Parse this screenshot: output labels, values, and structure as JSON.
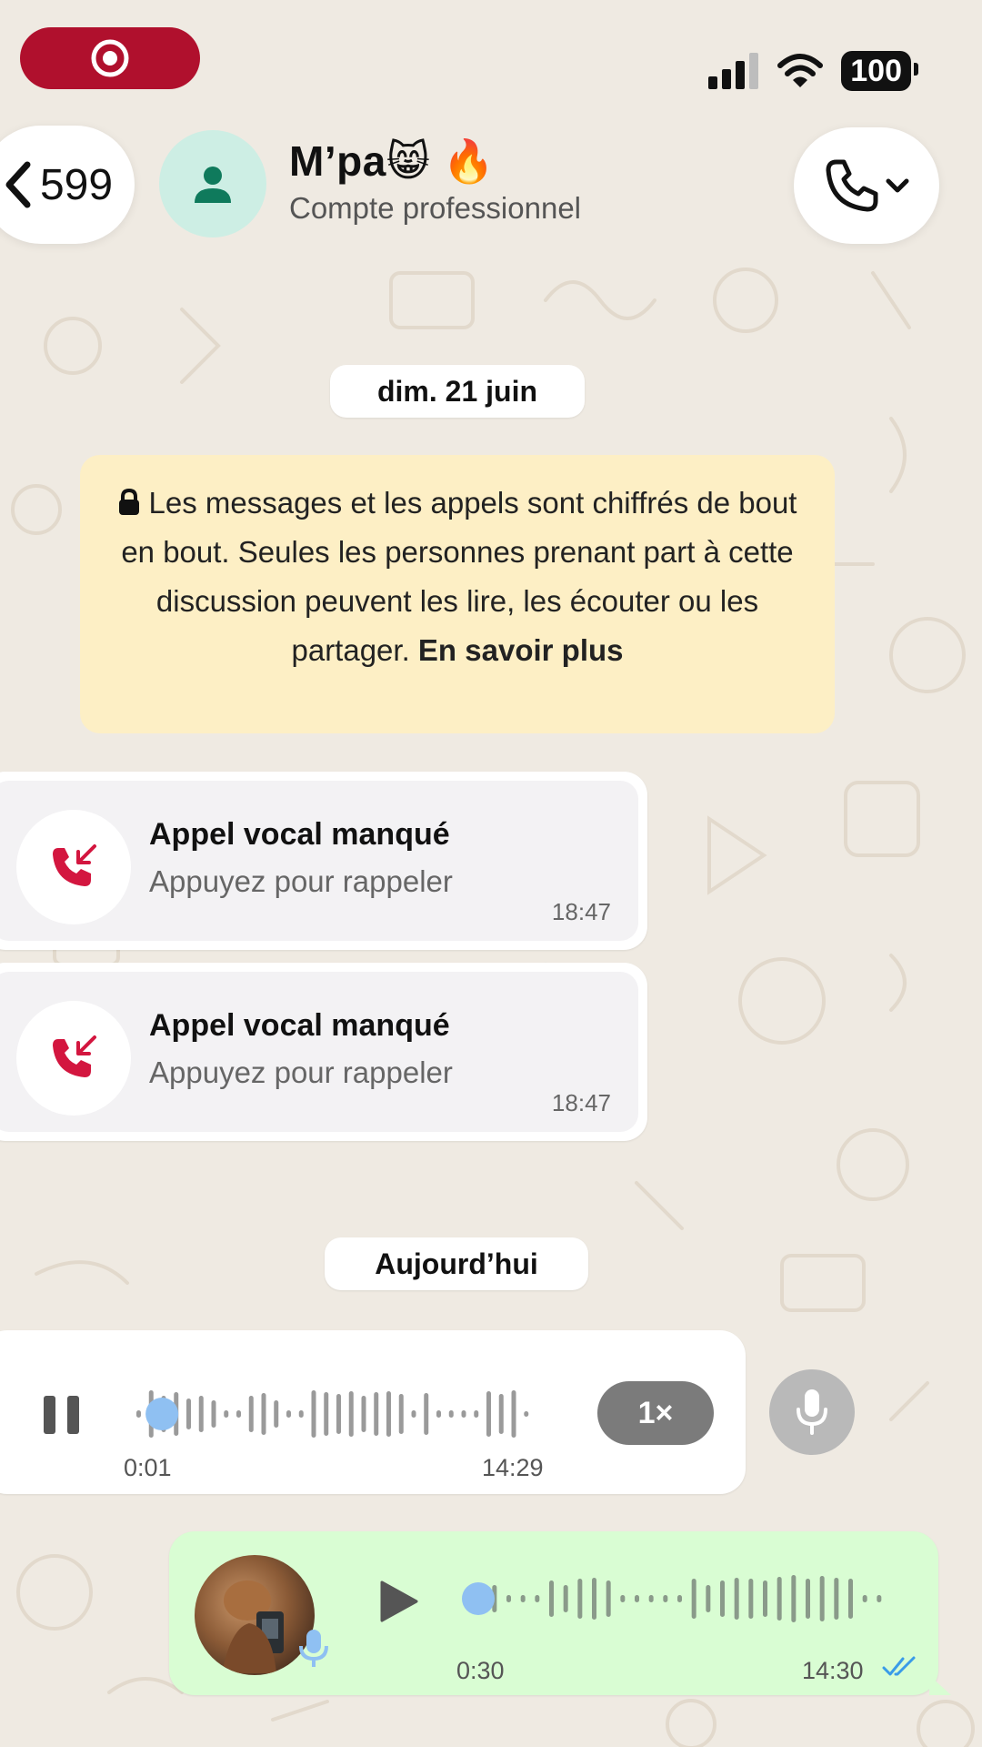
{
  "status_bar": {
    "battery": "100"
  },
  "header": {
    "back_count": "599",
    "contact_name": "M’pa😸 🔥",
    "contact_subtitle": "Compte professionnel"
  },
  "chips": {
    "date_first": "dim. 21 juin",
    "date_today": "Aujourd’hui"
  },
  "encryption_notice": {
    "text": "Les messages et les appels sont chiffrés de bout en bout. Seules les personnes prenant part à cette discussion peuvent les lire, les écouter ou les partager.",
    "link": "En savoir plus"
  },
  "missed_calls": [
    {
      "title": "Appel vocal manqué",
      "subtitle": "Appuyez pour rappeler",
      "time": "18:47"
    },
    {
      "title": "Appel vocal manqué",
      "subtitle": "Appuyez pour rappeler",
      "time": "18:47"
    }
  ],
  "voice_incoming": {
    "elapsed": "0:01",
    "time": "14:29",
    "speed": "1×",
    "progress": 0.03
  },
  "voice_outgoing": {
    "duration": "0:30",
    "time": "14:30",
    "progress": 0.0
  },
  "colors": {
    "wallpaper": "#efeae2",
    "outgoing_bubble": "#d9fdd3",
    "notice_bg": "#fdefc5",
    "missed_call_red": "#d3163f",
    "read_ticks": "#3a9be8",
    "recording_pill": "#b0102d"
  },
  "icons": {
    "recording": "record-icon",
    "signal": "signal-bars-icon",
    "wifi": "wifi-icon",
    "back": "chevron-left-icon",
    "avatar": "person-icon",
    "call": "phone-icon",
    "lock": "lock-icon",
    "missed_call": "missed-call-icon",
    "pause": "pause-icon",
    "play": "play-icon",
    "mic": "mic-icon",
    "read": "double-check-icon"
  }
}
